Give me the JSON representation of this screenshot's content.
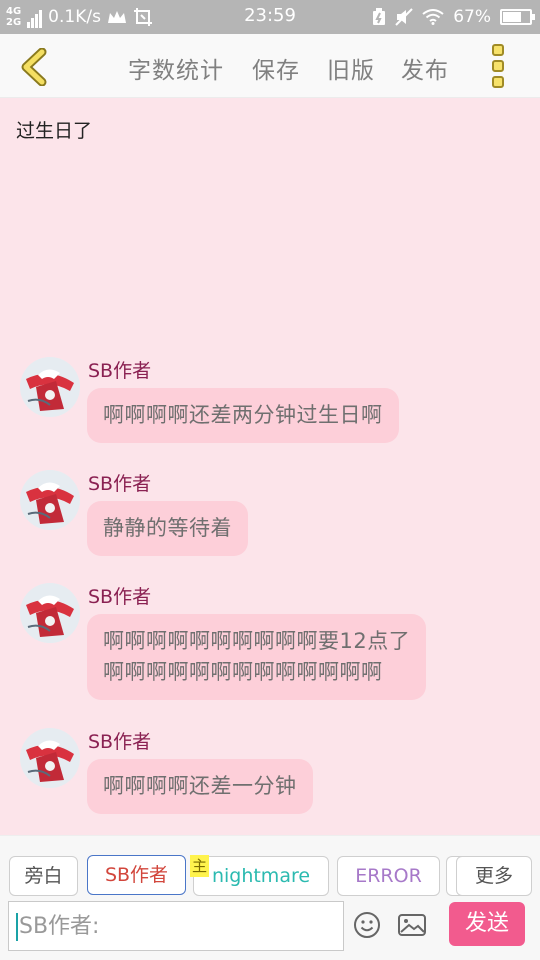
{
  "status_bar": {
    "network_top": "4G",
    "network_bottom": "2G",
    "speed": "0.1K/s",
    "time": "23:59",
    "battery": "67%"
  },
  "toolbar": {
    "word_count": "字数统计",
    "save": "保存",
    "old_version": "旧版",
    "publish": "发布"
  },
  "story_title": "过生日了",
  "messages": [
    {
      "speaker": "SB作者",
      "lines": [
        "啊啊啊啊还差两分钟过生日啊"
      ]
    },
    {
      "speaker": "SB作者",
      "lines": [
        "静静的等待着"
      ]
    },
    {
      "speaker": "SB作者",
      "lines": [
        "啊啊啊啊啊啊啊啊啊啊要12点了",
        "啊啊啊啊啊啊啊啊啊啊啊啊啊"
      ]
    },
    {
      "speaker": "SB作者",
      "lines": [
        "啊啊啊啊还差一分钟"
      ]
    }
  ],
  "characters": {
    "narrator": "旁白",
    "sb_author": "SB作者",
    "owner_tag": "主",
    "nightmare": "nightmare",
    "error": "ERROR",
    "more": "更多"
  },
  "input": {
    "placeholder": "SB作者:",
    "send": "发送"
  },
  "colors": {
    "background": "#fce4ea",
    "bubble": "#fdcfd9",
    "speaker": "#8a2152",
    "send_button": "#f25b8e",
    "selected_chip": "#4a76c8"
  }
}
